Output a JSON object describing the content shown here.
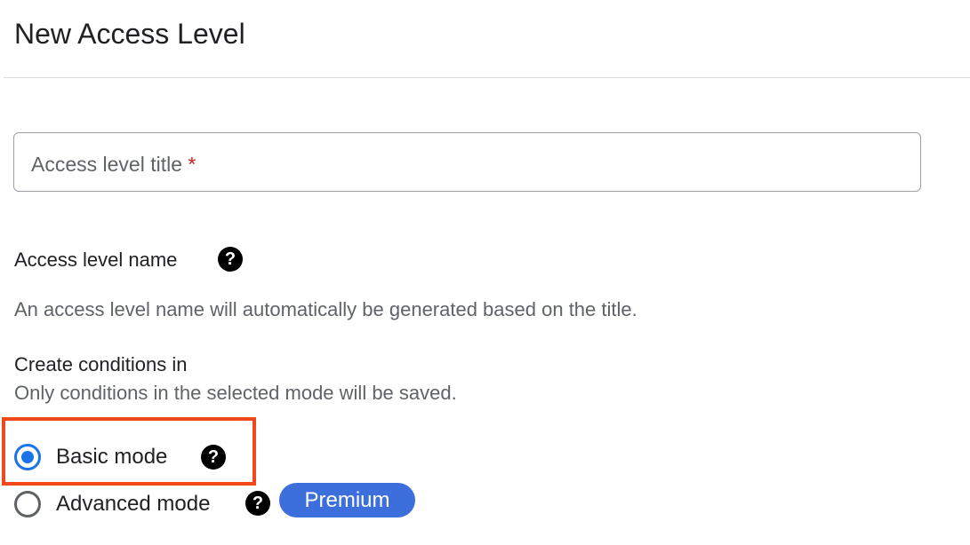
{
  "header": {
    "title": "New Access Level"
  },
  "form": {
    "title_field": {
      "placeholder": "Access level title",
      "required_marker": "*",
      "value": ""
    },
    "access_level_name": {
      "label": "Access level name",
      "help_icon": "help-circle-icon",
      "description": "An access level name will automatically be generated based on the title."
    },
    "conditions": {
      "label": "Create conditions in",
      "description": "Only conditions in the selected mode will be saved.",
      "options": [
        {
          "label": "Basic mode",
          "selected": true,
          "help_icon": "help-circle-icon"
        },
        {
          "label": "Advanced mode",
          "selected": false,
          "help_icon": "help-circle-icon",
          "badge": "Premium"
        }
      ]
    }
  },
  "colors": {
    "accent": "#1a73e8",
    "badge": "#3c6fdc",
    "highlight": "#f2481b",
    "required": "#c5221f"
  }
}
